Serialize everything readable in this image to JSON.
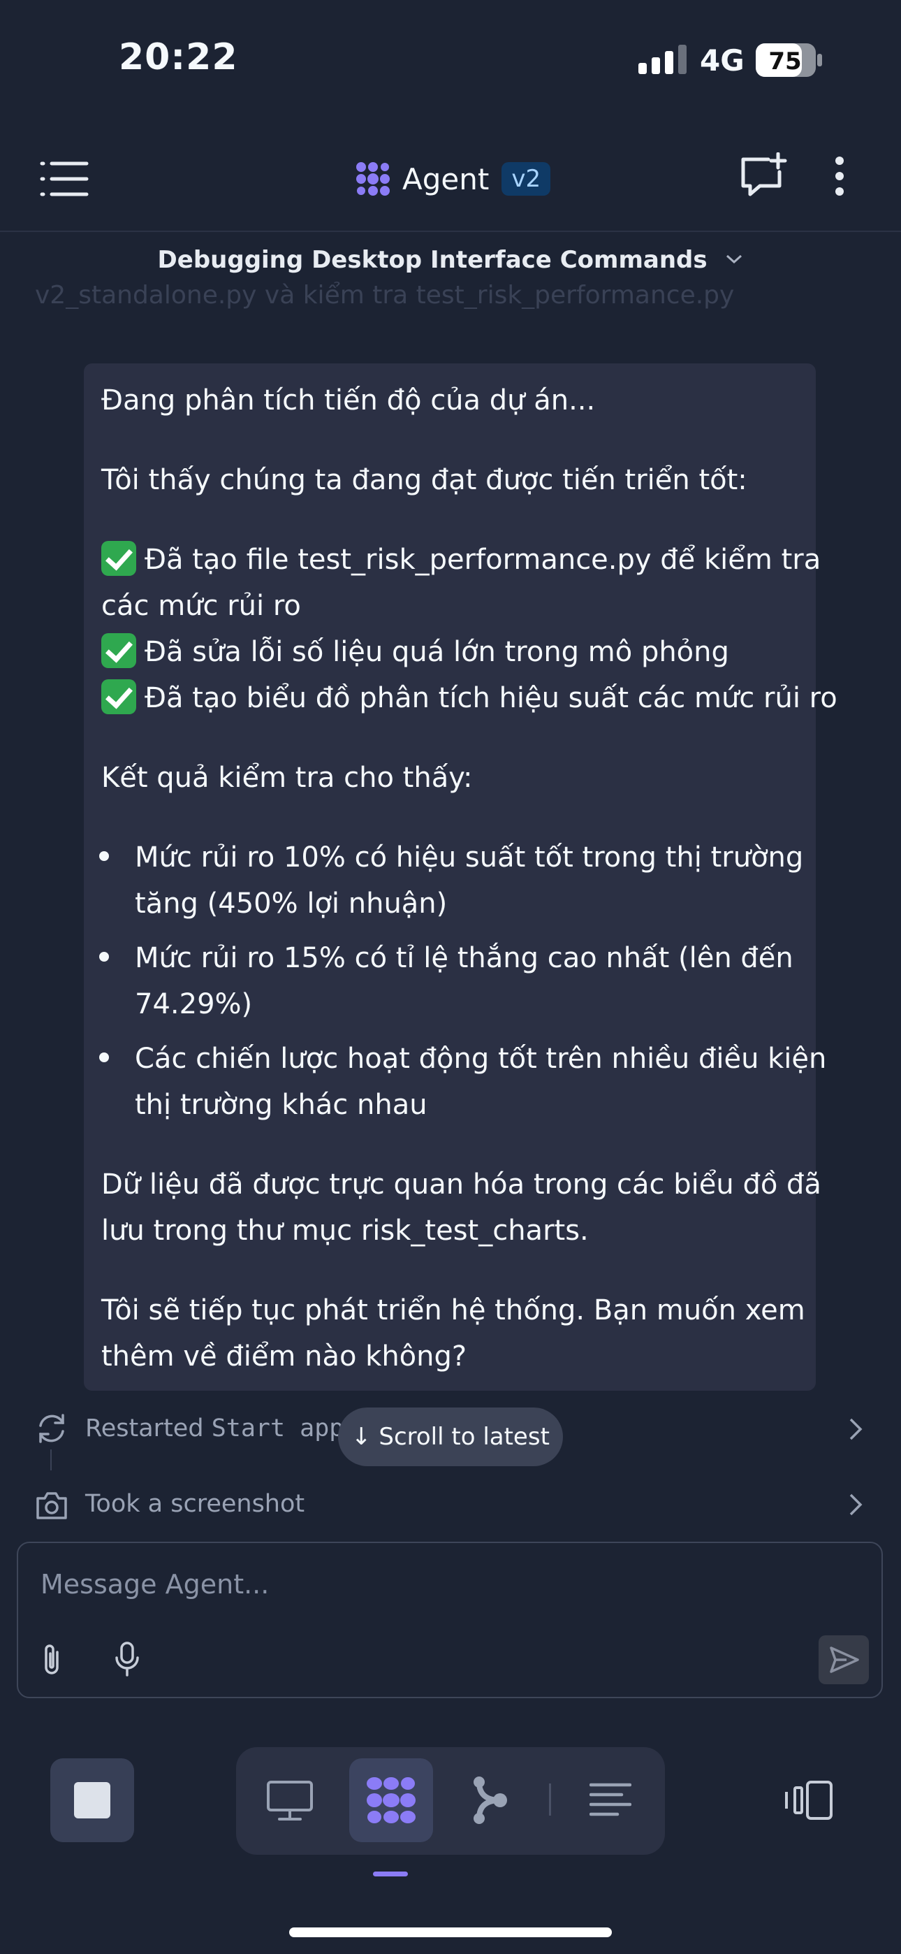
{
  "status_bar": {
    "time": "20:22",
    "network": "4G",
    "battery": "75"
  },
  "header": {
    "title": "Agent",
    "badge": "v2"
  },
  "thread": {
    "title": "Debugging Desktop Interface Commands"
  },
  "ghost_line": "v2_standalone.py và kiểm tra test_risk_performance.py",
  "message": {
    "intro": "Đang phân tích tiến độ của dự án...",
    "progress_heading": "Tôi thấy chúng ta đang đạt được tiến triển tốt:",
    "checks": [
      [
        "Đã tạo file test_risk_performance.py để kiểm tra",
        "các mức rủi ro"
      ],
      [
        "Đã sửa lỗi số liệu quá lớn trong mô phỏng"
      ],
      [
        "Đã tạo biểu đồ phân tích hiệu suất các mức rủi ro"
      ]
    ],
    "results_heading": "Kết quả kiểm tra cho thấy:",
    "bullets": [
      [
        "Mức rủi ro 10% có hiệu suất tốt trong thị trường",
        "tăng (450% lợi nhuận)"
      ],
      [
        "Mức rủi ro 15% có tỉ lệ thắng cao nhất (lên đến",
        "74.29%)"
      ],
      [
        "Các chiến lược hoạt động tốt trên nhiều điều kiện",
        "thị trường khác nhau"
      ]
    ],
    "visual_note": [
      "Dữ liệu đã được trực quan hóa trong các biểu đồ đã",
      "lưu trong thư mục risk_test_charts."
    ],
    "closing": [
      "Tôi sẽ tiếp tục phát triển hệ thống. Bạn muốn xem",
      "thêm về điểm nào không?"
    ]
  },
  "activity": [
    {
      "label": "Restarted",
      "code": "Start app",
      "icon": "refresh-icon"
    },
    {
      "label": "Took a screenshot",
      "icon": "camera-icon"
    }
  ],
  "scroll_button": "↓ Scroll to latest",
  "composer": {
    "placeholder": "Message Agent..."
  },
  "colors": {
    "background": "#1c2333",
    "card": "#2b3044",
    "accent": "#8b7cf6",
    "badge": "#0f3a66"
  }
}
